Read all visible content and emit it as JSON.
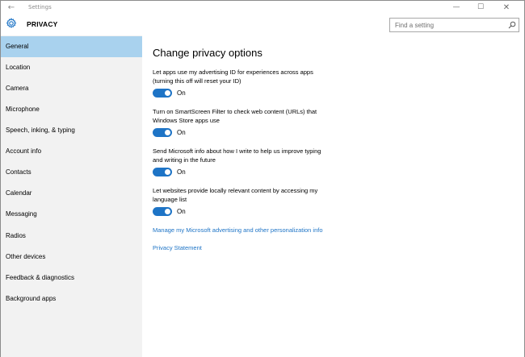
{
  "window": {
    "title": "Settings",
    "back_glyph": "←",
    "min_glyph": "—",
    "max_glyph": "☐",
    "close_glyph": "✕"
  },
  "header": {
    "title": "PRIVACY",
    "icon": "gear-icon"
  },
  "search": {
    "placeholder": "Find a setting",
    "icon": "search-icon"
  },
  "sidebar": {
    "items": [
      {
        "label": "General",
        "selected": true
      },
      {
        "label": "Location"
      },
      {
        "label": "Camera"
      },
      {
        "label": "Microphone"
      },
      {
        "label": "Speech, inking, & typing"
      },
      {
        "label": "Account info"
      },
      {
        "label": "Contacts"
      },
      {
        "label": "Calendar"
      },
      {
        "label": "Messaging"
      },
      {
        "label": "Radios"
      },
      {
        "label": "Other devices"
      },
      {
        "label": "Feedback & diagnostics"
      },
      {
        "label": "Background apps"
      }
    ]
  },
  "main": {
    "title": "Change privacy options",
    "settings": [
      {
        "line1": "Let apps use my advertising ID for experiences across apps",
        "line2": "(turning this off will reset your ID)",
        "state": "On",
        "on": true
      },
      {
        "line1": "Turn on SmartScreen Filter to check web content (URLs) that",
        "line2": "Windows Store apps use",
        "state": "On",
        "on": true
      },
      {
        "line1": "Send Microsoft info about how I write to help us improve typing",
        "line2": "and writing in the future",
        "state": "On",
        "on": true
      },
      {
        "line1": "Let websites provide locally relevant content by accessing my",
        "line2": "language list",
        "state": "On",
        "on": true
      }
    ],
    "links": [
      {
        "label": "Manage my Microsoft advertising and other personalization info"
      },
      {
        "label": "Privacy Statement"
      }
    ]
  },
  "colors": {
    "accent": "#1e74c6",
    "selected_nav": "#a9d2ee",
    "sidebar_bg": "#f2f2f2"
  }
}
